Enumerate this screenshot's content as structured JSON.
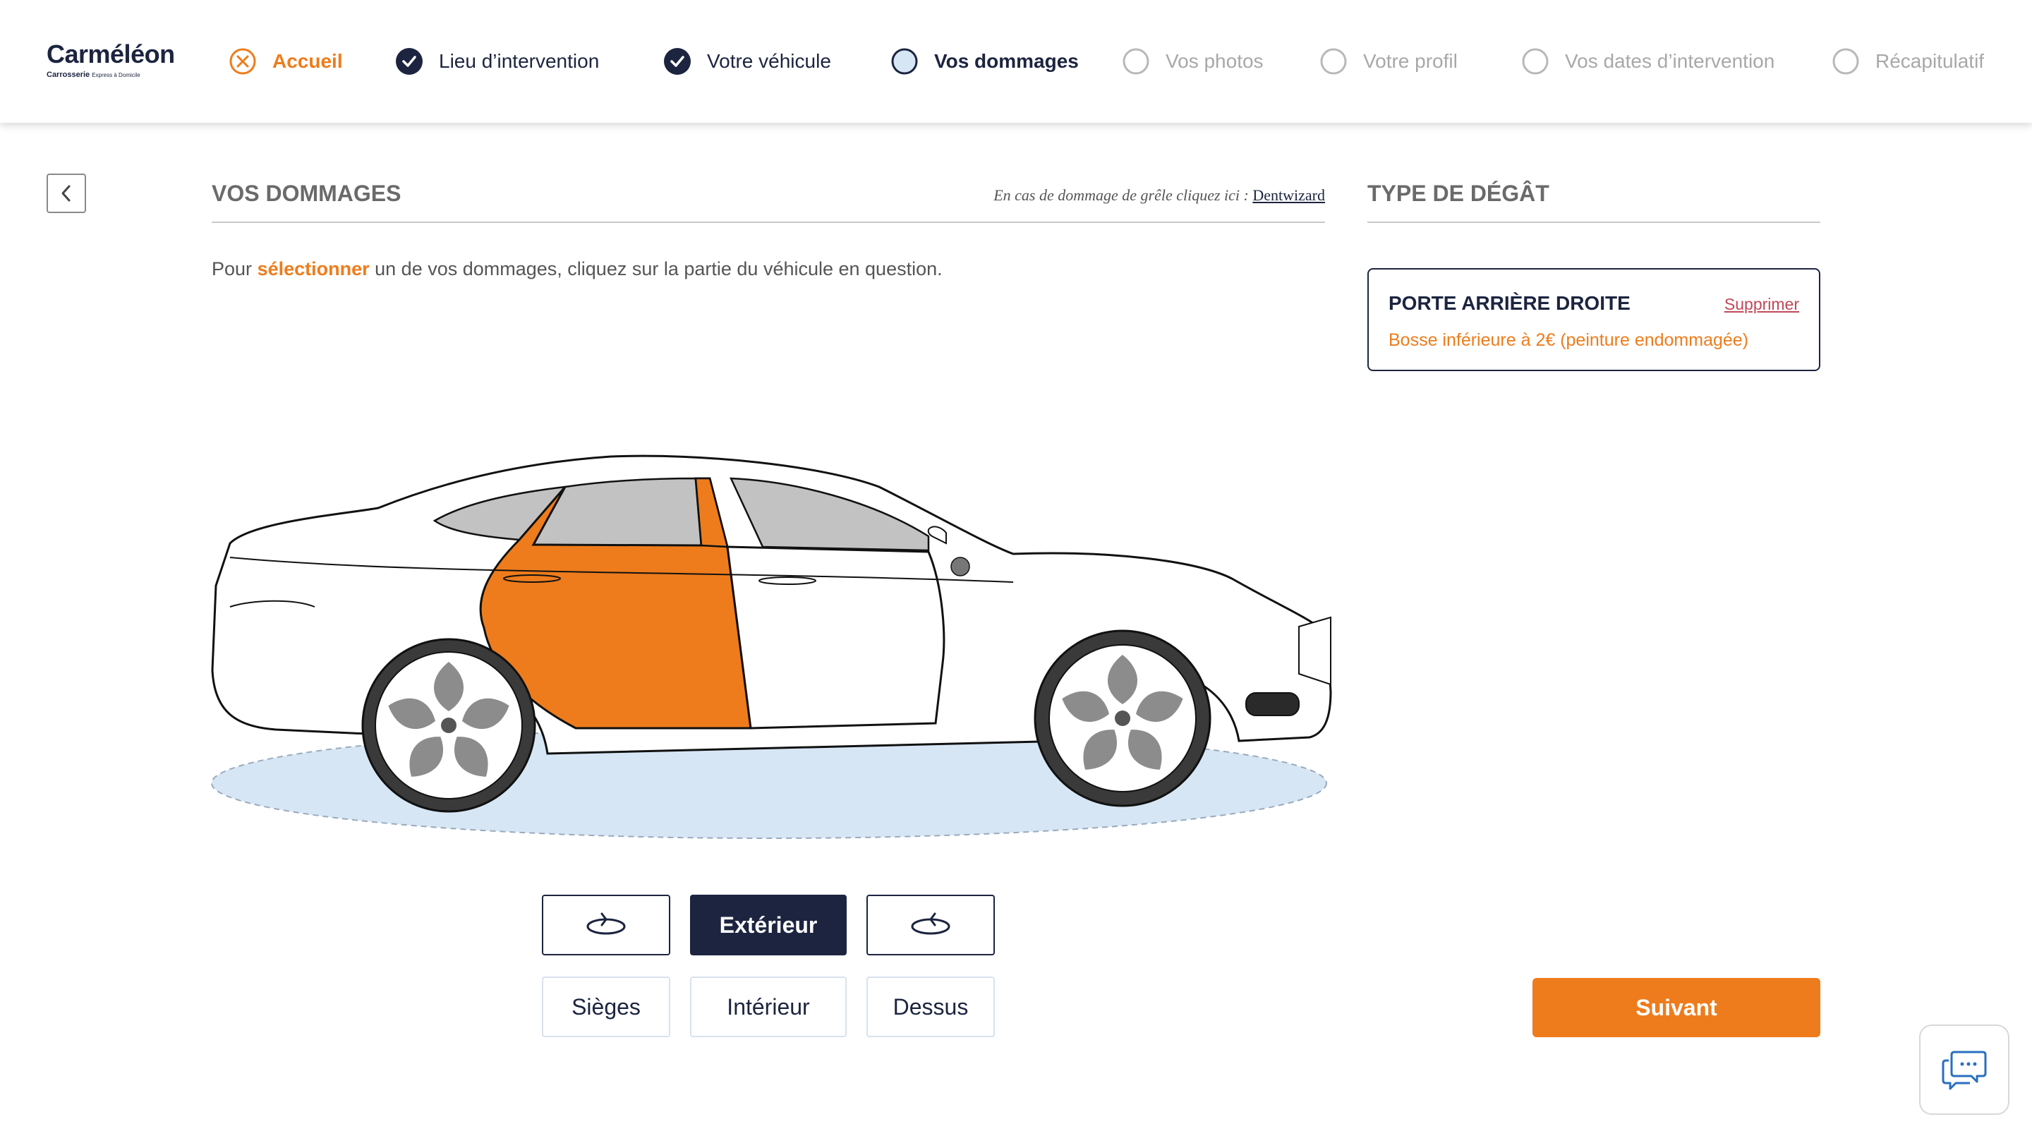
{
  "brand": {
    "name": "Carméléon",
    "tagline": "Carrosserie",
    "tagline_small": "Express à Domicile"
  },
  "steps": [
    {
      "label": "Accueil",
      "state": "first",
      "icon": "close-circle-icon"
    },
    {
      "label": "Lieu d’intervention",
      "state": "done",
      "icon": "check-circle-icon"
    },
    {
      "label": "Votre véhicule",
      "state": "done",
      "icon": "check-circle-icon"
    },
    {
      "label": "Vos dommages",
      "state": "current",
      "icon": "current-circle-icon"
    },
    {
      "label": "Vos photos",
      "state": "todo",
      "icon": "empty-circle-icon"
    },
    {
      "label": "Votre profil",
      "state": "todo",
      "icon": "empty-circle-icon"
    },
    {
      "label": "Vos dates d’intervention",
      "state": "todo",
      "icon": "empty-circle-icon"
    },
    {
      "label": "Récapitulatif",
      "state": "todo",
      "icon": "empty-circle-icon"
    }
  ],
  "main": {
    "title": "VOS DOMMAGES",
    "hail_text": "En cas de dommage de grêle cliquez ici :",
    "hail_link": "Dentwizard",
    "instruction_before": "Pour",
    "instruction_highlight": "sélectionner",
    "instruction_after": "un de vos dommages, cliquez sur la partie du véhicule en question.",
    "selected_part": "rear-right-door"
  },
  "side": {
    "title": "TYPE DE DÉGÂT",
    "damage": {
      "name": "PORTE ARRIÈRE DROITE",
      "delete_label": "Supprimer",
      "description": "Bosse inférieure à 2€ (peinture endommagée)"
    }
  },
  "view_controls": {
    "rotate_left_icon": "rotate-left-icon",
    "active_view": "Extérieur",
    "rotate_right_icon": "rotate-right-icon",
    "other_views": [
      "Sièges",
      "Intérieur",
      "Dessus"
    ]
  },
  "actions": {
    "next_label": "Suivant",
    "chat_icon": "chat-icon"
  },
  "colors": {
    "navy": "#1c2440",
    "orange": "#ee7c1c",
    "grey": "#a8a8a8",
    "ground": "#d6e6f5",
    "delete": "#c0485a"
  }
}
